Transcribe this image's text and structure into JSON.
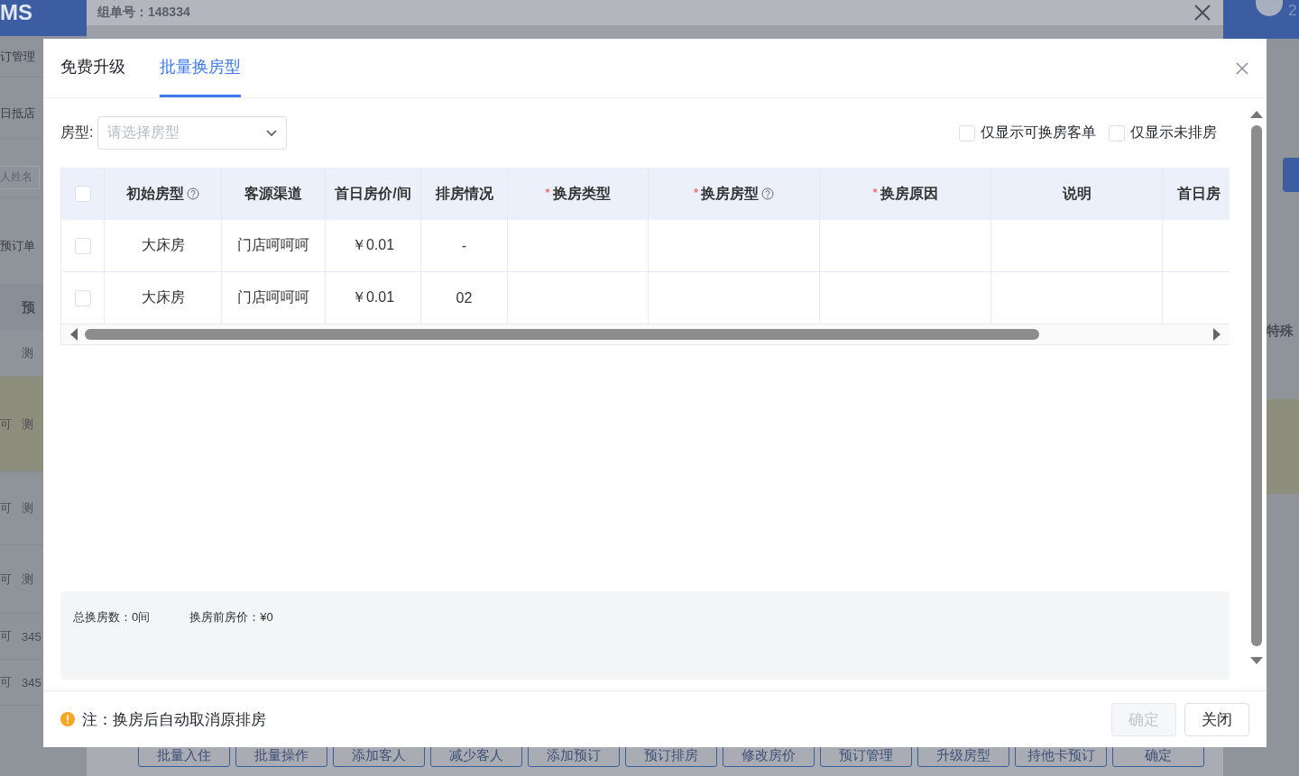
{
  "background": {
    "logo": "MS",
    "group_number": "组单号：148334",
    "sidebar_items": [
      "订管理",
      "日抵店"
    ],
    "name_placeholder": "人姓名",
    "order_count_label": "预订单",
    "list_header": "预",
    "list_rows": [
      {
        "c1": "",
        "c2": "测",
        "highlighted": false
      },
      {
        "c1": "可",
        "c2": "测",
        "highlighted": true
      },
      {
        "c1": "可",
        "c2": "测",
        "highlighted": false
      },
      {
        "c1": "可",
        "c2": "测",
        "highlighted": false
      },
      {
        "c1": "可",
        "c2": "345",
        "highlighted": false
      },
      {
        "c1": "可",
        "c2": "345",
        "highlighted": false
      }
    ],
    "user_text": "2",
    "right_header": "特殊",
    "action_buttons": [
      "批量入住",
      "批量操作",
      "添加客人",
      "减少客人",
      "添加预订",
      "预订排房",
      "修改房价",
      "预订管理",
      "升级房型",
      "持他卡预订",
      "确定"
    ]
  },
  "dialog": {
    "tabs": [
      {
        "label": "免费升级",
        "selected": false
      },
      {
        "label": "批量换房型",
        "selected": true
      }
    ],
    "filter": {
      "label": "房型:",
      "placeholder": "请选择房型"
    },
    "options": [
      {
        "label": "仅显示可换房客单",
        "checked": false
      },
      {
        "label": "仅显示未排房",
        "checked": false
      }
    ],
    "table": {
      "all_selected": false,
      "columns": [
        {
          "label": "初始房型",
          "help": true
        },
        {
          "label": "客源渠道",
          "help": false
        },
        {
          "label": "首日房价/间",
          "help": false
        },
        {
          "label": "排房情况",
          "help": false
        },
        {
          "label": "换房类型",
          "required_mark": "*",
          "help": false
        },
        {
          "label": "换房房型",
          "required_mark": "*",
          "help": true
        },
        {
          "label": "换房原因",
          "required_mark": "*",
          "help": false
        },
        {
          "label": "说明",
          "help": false
        },
        {
          "label": "首日房",
          "help": false
        }
      ],
      "rows": [
        {
          "selected": false,
          "cells": [
            "大床房",
            "门店呵呵呵",
            "￥0.01",
            "-"
          ]
        },
        {
          "selected": false,
          "cells": [
            "大床房",
            "门店呵呵呵",
            "￥0.01",
            "02"
          ]
        }
      ]
    },
    "summary": [
      "总换房数：0间",
      "换房前房价：¥0"
    ],
    "note": "注：换房后自动取消原排房",
    "buttons": [
      {
        "label": "确定",
        "disabled": true
      },
      {
        "label": "关闭",
        "disabled": false
      }
    ]
  }
}
